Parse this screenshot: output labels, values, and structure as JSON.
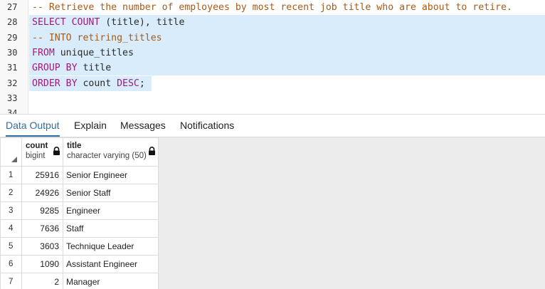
{
  "editor": {
    "lines": [
      {
        "num": "27",
        "selected": false,
        "tokens": [
          {
            "t": "-- Retrieve the number of employees by most recent job title who are about to retire.",
            "c": "cm"
          }
        ]
      },
      {
        "num": "28",
        "selected": true,
        "tokens": [
          {
            "t": "SELECT",
            "c": "kw"
          },
          {
            "t": " ",
            "c": "tx"
          },
          {
            "t": "COUNT",
            "c": "kw"
          },
          {
            "t": " (title), title",
            "c": "tx"
          }
        ]
      },
      {
        "num": "29",
        "selected": true,
        "tokens": [
          {
            "t": "-- INTO retiring_titles",
            "c": "cm"
          }
        ]
      },
      {
        "num": "30",
        "selected": true,
        "tokens": [
          {
            "t": "FROM",
            "c": "kw"
          },
          {
            "t": " unique_titles",
            "c": "tx"
          }
        ]
      },
      {
        "num": "31",
        "selected": true,
        "tokens": [
          {
            "t": "GROUP BY",
            "c": "kw"
          },
          {
            "t": " title",
            "c": "tx"
          }
        ]
      },
      {
        "num": "32",
        "selected": true,
        "tokens": [
          {
            "t": "ORDER BY",
            "c": "kw"
          },
          {
            "t": " count ",
            "c": "tx"
          },
          {
            "t": "DESC",
            "c": "kw"
          },
          {
            "t": ";",
            "c": "tx"
          }
        ]
      },
      {
        "num": "33",
        "selected": false,
        "tokens": []
      },
      {
        "num": "34",
        "selected": false,
        "tokens": []
      }
    ]
  },
  "tabs": [
    {
      "label": "Data Output",
      "active": true
    },
    {
      "label": "Explain",
      "active": false
    },
    {
      "label": "Messages",
      "active": false
    },
    {
      "label": "Notifications",
      "active": false
    }
  ],
  "grid": {
    "columns": [
      {
        "name": "count",
        "type": "bigint"
      },
      {
        "name": "title",
        "type": "character varying (50)"
      }
    ],
    "rows": [
      {
        "n": "1",
        "count": "25916",
        "title": "Senior Engineer"
      },
      {
        "n": "2",
        "count": "24926",
        "title": "Senior Staff"
      },
      {
        "n": "3",
        "count": "9285",
        "title": "Engineer"
      },
      {
        "n": "4",
        "count": "7636",
        "title": "Staff"
      },
      {
        "n": "5",
        "count": "3603",
        "title": "Technique Leader"
      },
      {
        "n": "6",
        "count": "1090",
        "title": "Assistant Engineer"
      },
      {
        "n": "7",
        "count": "2",
        "title": "Manager"
      }
    ]
  },
  "colors": {
    "selection": "#d8ecfb",
    "keyword": "#9d1c7a",
    "comment": "#a75a18",
    "active_tab": "#2f6da3"
  }
}
